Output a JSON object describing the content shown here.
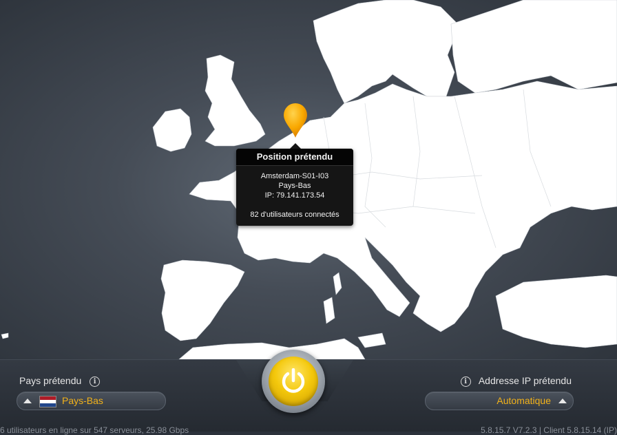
{
  "tooltip": {
    "title": "Position prétendu",
    "server": "Amsterdam-S01-I03",
    "country": "Pays-Bas",
    "ip": "IP: 79.141.173.54",
    "users": "82 d'utilisateurs connectés"
  },
  "left_panel": {
    "label": "Pays prétendu",
    "selected_country": "Pays-Bas",
    "flag_colors": [
      "#ae1c28",
      "#ffffff",
      "#21468b"
    ]
  },
  "right_panel": {
    "label": "Addresse IP prétendu",
    "selected_ip": "Automatique"
  },
  "footer": {
    "left": "6 utilisateurs en ligne sur 547 serveurs, 25.98 Gbps",
    "right": "5.8.15.7 V7.2.3 | Client 5.8.15.14 (IP)"
  },
  "colors": {
    "accent": "#f2b21a",
    "pin": "#f9a800",
    "land": "#ffffff",
    "sea": "#454c56"
  },
  "icons": {
    "info": "info-icon",
    "power": "power-icon",
    "pin": "map-pin-icon"
  }
}
